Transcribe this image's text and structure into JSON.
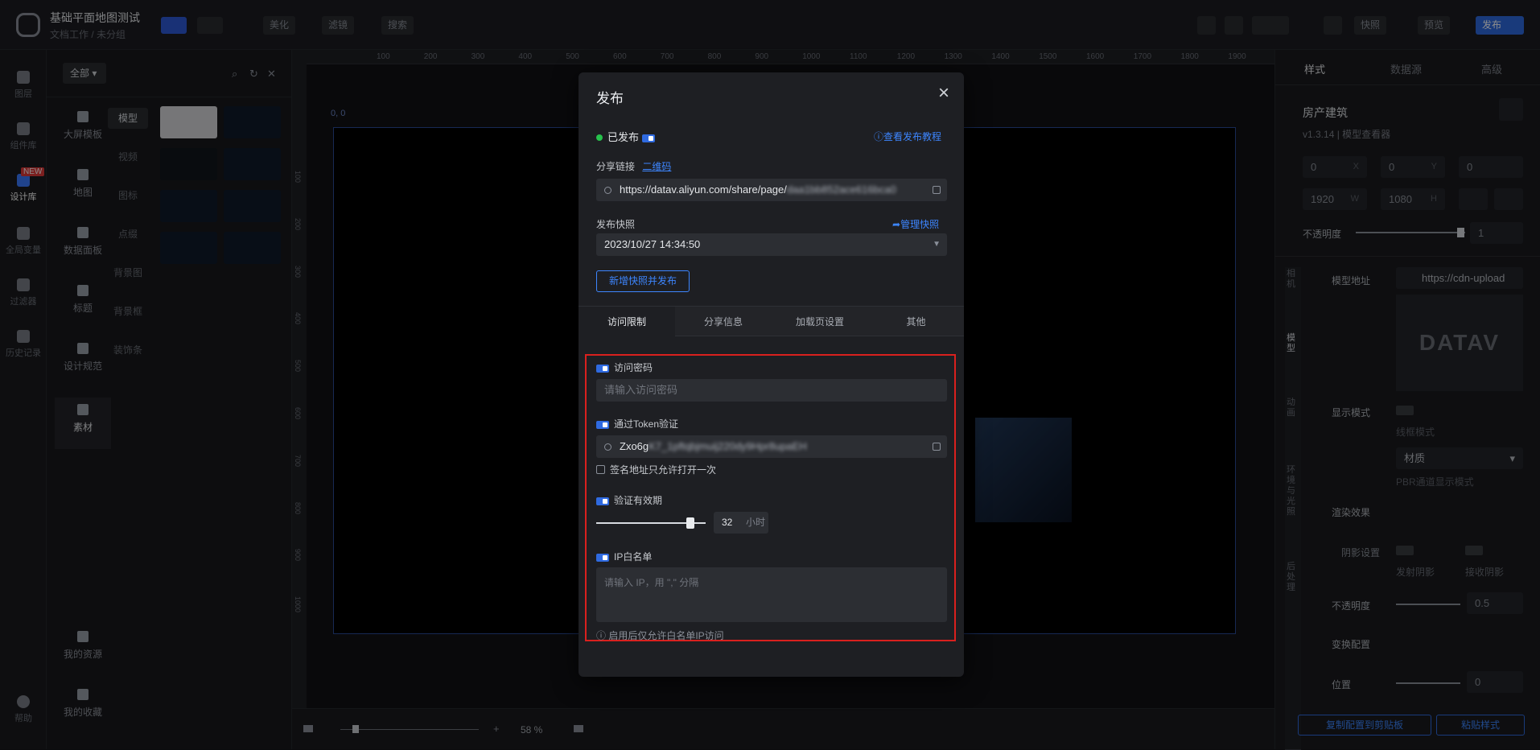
{
  "header": {
    "title": "基础平面地图测试",
    "breadcrumb": "文档工作 / 未分组",
    "tools": [
      "美化",
      "滤镜",
      "搜索"
    ],
    "right_buttons": {
      "snapshot": "快照",
      "preview": "预览",
      "publish": "发布"
    }
  },
  "leftbar": {
    "items": [
      "图层",
      "组件库",
      "设计库",
      "全局变量",
      "过滤器",
      "历史记录"
    ],
    "new_badge": "NEW",
    "help": "帮助"
  },
  "library": {
    "filter": "全部",
    "categories": [
      "大屏模板",
      "地图",
      "数据面板",
      "标题",
      "设计规范",
      "素材"
    ],
    "subcategories": [
      "模型",
      "视频",
      "图标",
      "点缀",
      "背景图",
      "背景框",
      "装饰条"
    ],
    "bottom": [
      "我的资源",
      "我的收藏"
    ]
  },
  "canvas": {
    "ruler_ticks": [
      "100",
      "200",
      "300",
      "400",
      "500",
      "600",
      "700",
      "800",
      "900",
      "1000",
      "1100",
      "1200",
      "1300",
      "1400",
      "1500",
      "1600",
      "1700",
      "1800",
      "1900"
    ],
    "vertical_ticks": [
      "100",
      "200",
      "300",
      "400",
      "500",
      "600",
      "700",
      "800",
      "900",
      "1000"
    ],
    "origin": "0, 0",
    "zoom": "58 %"
  },
  "rightpanel": {
    "tabs": [
      "样式",
      "数据源",
      "高级"
    ],
    "component_name": "房产建筑",
    "version": "v1.3.14 | 模型查看器",
    "x": "0",
    "x_label": "X",
    "y": "0",
    "y_label": "Y",
    "z": "0",
    "width": "1920",
    "w_label": "W",
    "height": "1080",
    "h_label": "H",
    "opacity_label": "不透明度",
    "opacity": "1",
    "side_tabs": [
      "相机",
      "模型",
      "动画",
      "环境与光照",
      "后处理"
    ],
    "model_url_label": "模型地址",
    "model_url": "https://cdn-upload",
    "display_mode_label": "显示模式",
    "wireframe_label": "线框模式",
    "shading": "材质",
    "pbr_label": "PBR通道显示模式",
    "render_effect": "渲染效果",
    "shadow_label": "阴影设置",
    "cast_shadow": "发射阴影",
    "receive_shadow": "接收阴影",
    "opacity2_label": "不透明度",
    "opacity2": "0.5",
    "transform": "变换配置",
    "position_label": "位置",
    "position": "0",
    "copy_btn": "复制配置到剪贴板",
    "paste_btn": "粘贴样式"
  },
  "modal": {
    "title": "发布",
    "status": "已发布",
    "tutorial_link": "查看发布教程",
    "share_label": "分享链接",
    "qr_link": "二维码",
    "share_url": "https://datav.aliyun.com/share/page/",
    "share_url_hidden": "daa1bb852ace616bca0",
    "snapshot_label": "发布快照",
    "manage_link": "管理快照",
    "snapshot_value": "2023/10/27 14:34:50",
    "new_snapshot_btn": "新增快照并发布",
    "tabs": [
      "访问限制",
      "分享信息",
      "加载页设置",
      "其他"
    ],
    "password_label": "访问密码",
    "password_placeholder": "请输入访问密码",
    "token_label": "通过Token验证",
    "token_value": "Zxo6g",
    "token_hidden": "K7_1pftqbjmuij220dy9Hpr8upaEH",
    "once_label": "签名地址只允许打开一次",
    "validity_label": "验证有效期",
    "validity_value": "32",
    "validity_unit": "小时",
    "validity_fraction": 0.82,
    "ip_label": "IP白名单",
    "ip_placeholder": "请输入 IP，用 \",\" 分隔",
    "ip_hint": "启用后仅允许白名单IP访问"
  }
}
